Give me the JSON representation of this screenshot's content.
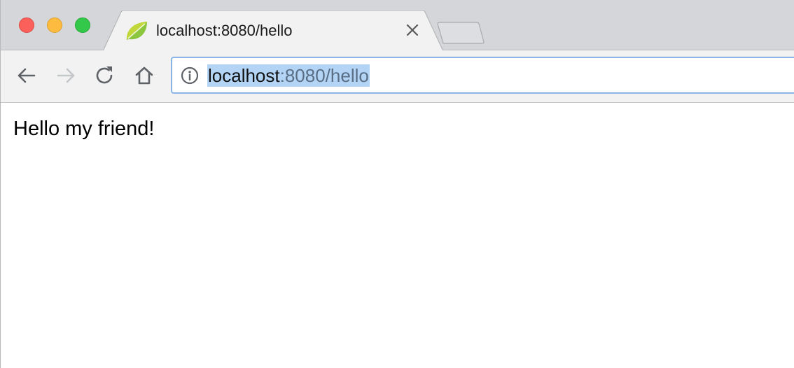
{
  "window": {
    "buttons": {
      "close": "close",
      "minimize": "minimize",
      "maximize": "maximize"
    }
  },
  "tab": {
    "title": "localhost:8080/hello",
    "favicon": "spring-leaf-icon"
  },
  "toolbar": {
    "back_icon": "back-arrow-icon",
    "forward_icon": "forward-arrow-icon",
    "reload_icon": "reload-icon",
    "home_icon": "home-icon"
  },
  "address_bar": {
    "host": "localhost",
    "rest": ":8080/hello",
    "icon": "info-icon"
  },
  "page": {
    "text": "Hello my friend!"
  },
  "colors": {
    "accent_focus": "#8ab4e8",
    "selection": "#b3d4f5",
    "spring_green": "#6db33f"
  }
}
